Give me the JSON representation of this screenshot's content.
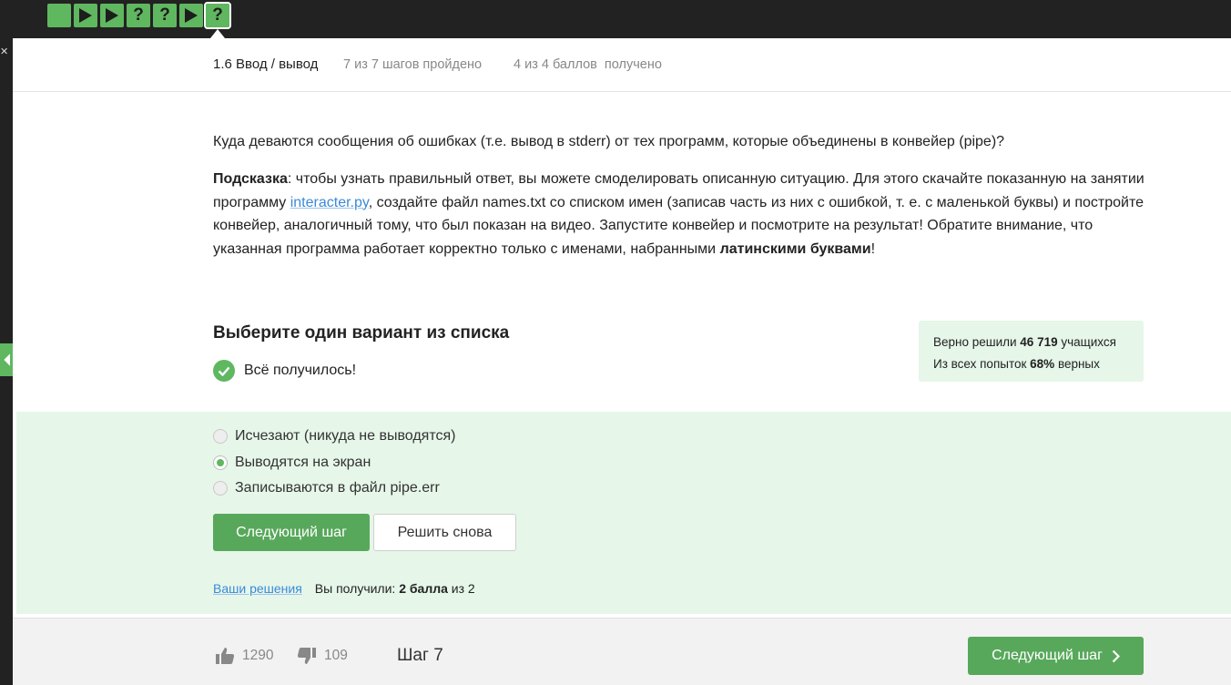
{
  "step_nav": {
    "items": [
      {
        "icon": "blank"
      },
      {
        "icon": "play"
      },
      {
        "icon": "play"
      },
      {
        "icon": "question",
        "text": "?"
      },
      {
        "icon": "question",
        "text": "?"
      },
      {
        "icon": "play"
      },
      {
        "icon": "question",
        "text": "?",
        "active": true
      }
    ]
  },
  "header": {
    "title": "1.6 Ввод / вывод",
    "steps_progress": "7 из 7 шагов пройдено",
    "points": "4 из 4 баллов  получено"
  },
  "question": {
    "text": "Куда деваются сообщения об ошибках (т.е. вывод в stderr) от тех программ, которые объединены в конвейер (pipe)?",
    "hint_label": "Подсказка",
    "hint_part1": ": чтобы узнать правильный ответ, вы можете смоделировать описанную ситуацию. Для этого скачайте показанную на занятии программу ",
    "hint_link": "interacter.py",
    "hint_part2": ", создайте файл names.txt со списком имен (записав часть из них с ошибкой, т. е. с маленькой буквы) и постройте конвейер, аналогичный тому, что был показан на видео. Запустите конвейер и посмотрите на результат! Обратите внимание, что указанная программа работает корректно только с именами, набранными ",
    "hint_bold": "латинскими буквами",
    "hint_end": "!"
  },
  "quiz": {
    "title": "Выберите один вариант из списка",
    "success_text": "Всё получилось!",
    "stats_line1_pre": "Верно решили ",
    "stats_line1_num": "46 719",
    "stats_line1_post": " учащихся",
    "stats_line2_pre": "Из всех попыток ",
    "stats_line2_num": "68%",
    "stats_line2_post": " верных",
    "options": [
      {
        "label": "Исчезают (никуда не выводятся)",
        "selected": false
      },
      {
        "label": "Выводятся на экран",
        "selected": true
      },
      {
        "label": "Записываются в файл pipe.err",
        "selected": false
      }
    ],
    "next_button": "Следующий шаг",
    "retry_button": "Решить снова",
    "solutions_link": "Ваши решения",
    "score_pre": "Вы получили: ",
    "score_value": "2 балла",
    "score_post": " из 2"
  },
  "footer": {
    "likes": "1290",
    "dislikes": "109",
    "step_label": "Шаг 7",
    "next_button": "Следующий шаг"
  },
  "colors": {
    "accent": "#5fb760",
    "button": "#58a85b",
    "correct_bg": "#e6f6e9",
    "topbar": "#222222",
    "link": "#3a8ad8"
  }
}
